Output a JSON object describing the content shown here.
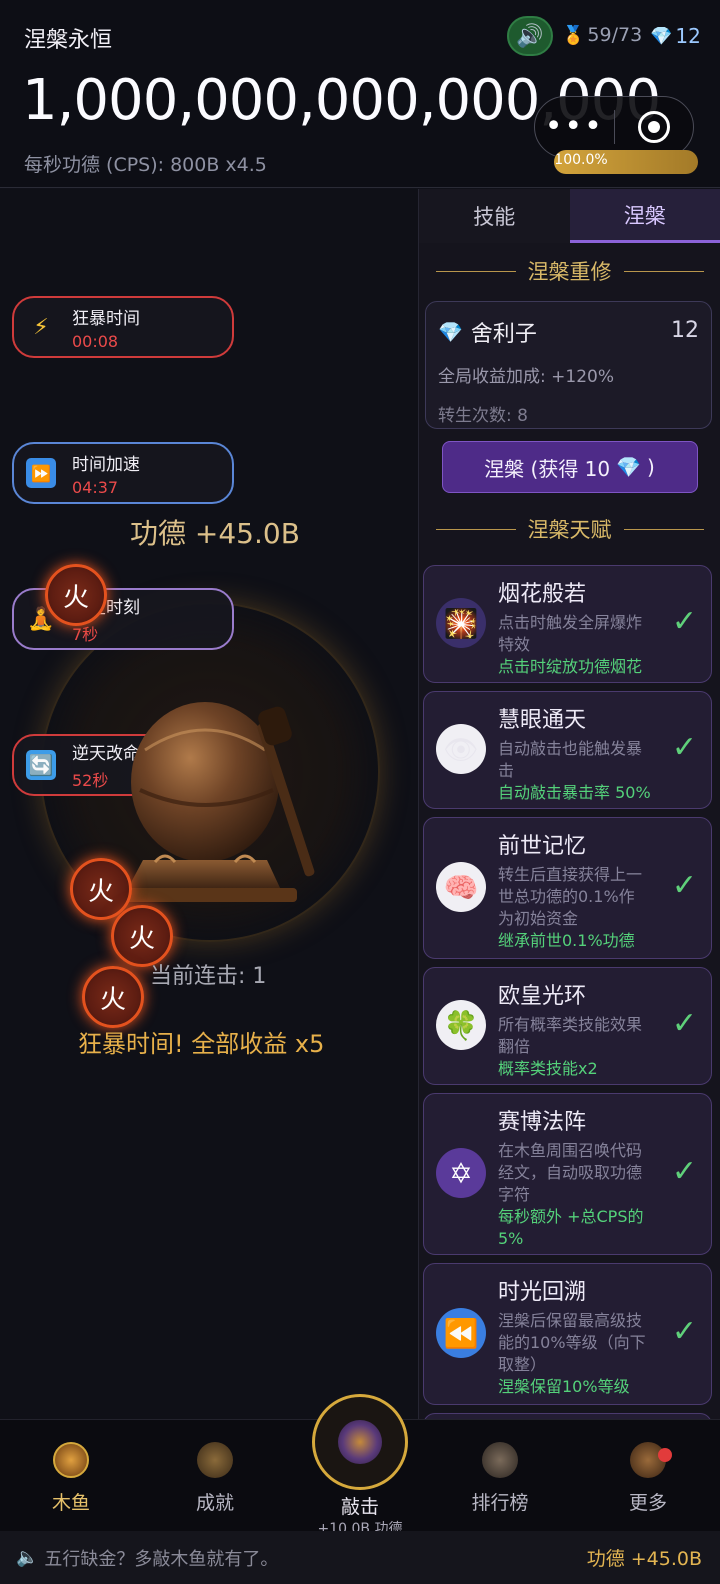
{
  "header": {
    "title": "涅槃永恒",
    "medal_value": "59/73",
    "gem_value": "12",
    "total_merit": "1,000,000,000,000,000",
    "cps": "每秒功德 (CPS): 800B x4.5",
    "progress_text": "100.0%",
    "progress_fraction": 1.0
  },
  "buffs": [
    {
      "name": "狂暴时间",
      "time": "00:08",
      "icon": "lightning-icon"
    },
    {
      "name": "时间加速",
      "time": "04:37",
      "icon": "fast-forward-icon"
    },
    {
      "name": "禅定时刻",
      "time": "7秒",
      "icon": "meditation-icon"
    },
    {
      "name": "逆天改命",
      "time": "52秒",
      "icon": "cycle-icon"
    }
  ],
  "game": {
    "merit_float": "功德 +45.0B",
    "fire_char": "火",
    "combo": "当前连击: 1",
    "frenzy_text": "狂暴时间! 全部收益 x5"
  },
  "panel": {
    "tabs": [
      "技能",
      "涅槃"
    ],
    "active_tab": 1,
    "rebirth_title": "涅槃重修",
    "sarira_name": "舍利子",
    "sarira_count": "12",
    "global_bonus": "全局收益加成: +120%",
    "rebirth_count": "转生次数: 8",
    "nirvana_button": "涅槃 (获得 10",
    "nirvana_button_end": ")",
    "talent_title": "涅槃天赋",
    "talents": [
      {
        "name": "烟花般若",
        "desc": "点击时触发全屏爆炸特效",
        "effect": "点击时绽放功德烟花",
        "icon": "firework-icon"
      },
      {
        "name": "慧眼通天",
        "desc": "自动敲击也能触发暴击",
        "effect": "自动敲击暴击率 50%",
        "icon": "eye-icon"
      },
      {
        "name": "前世记忆",
        "desc": "转生后直接获得上一世总功德的0.1%作为初始资金",
        "effect": "继承前世0.1%功德",
        "icon": "brain-icon"
      },
      {
        "name": "欧皇光环",
        "desc": "所有概率类技能效果翻倍",
        "effect": "概率类技能x2",
        "icon": "clover-icon"
      },
      {
        "name": "赛博法阵",
        "desc": "在木鱼周围召唤代码经文，自动吸取功德字符",
        "effect": "每秒额外 +总CPS的5%",
        "icon": "star-of-david-icon"
      },
      {
        "name": "时光回溯",
        "desc": "涅槃后保留最高级技能的10%等级（向下取整）",
        "effect": "涅槃保留10%等级",
        "icon": "rewind-icon"
      }
    ]
  },
  "nav": {
    "items": [
      "木鱼",
      "成就",
      "敲击",
      "排行榜",
      "更多"
    ],
    "strike_sub": "+10.0B 功德",
    "active": 0
  },
  "ticker": {
    "message": "五行缺金？多敲木鱼就有了。",
    "merit": "功德 +45.0B"
  }
}
